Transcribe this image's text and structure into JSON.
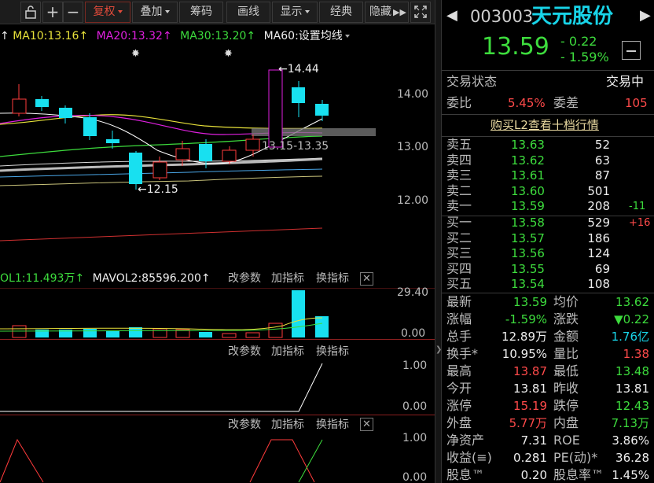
{
  "toolbar": {
    "fuquan": "复权",
    "diejia": "叠加",
    "chouma": "筹码",
    "huaxian": "画线",
    "xianshi": "显示",
    "jingdian": "经典",
    "yincang": "隐藏"
  },
  "ma_bar": {
    "ma10": "MA10:13.16",
    "ma20": "MA20:13.32",
    "ma30": "MA30:13.20",
    "ma60": "MA60:",
    "settings": "设置均线"
  },
  "price_axis": [
    "14.00",
    "13.00",
    "12.00"
  ],
  "annotations": {
    "high": "14.44",
    "low": "12.15",
    "range": "13.15-13.35"
  },
  "vol_bar": {
    "vol1": "OL1:11.493万",
    "mavol2": "MAVOL2:85596.200"
  },
  "indicator_buttons": {
    "change_params": "改参数",
    "add_indicator": "加指标",
    "switch_indicator": "换指标"
  },
  "vol_axis": [
    "29.40",
    "0.00"
  ],
  "ind1_axis": [
    "1.00",
    "0.00"
  ],
  "ind2_axis": [
    "1.00",
    "0.00"
  ],
  "colors": {
    "up": "#ff3b3b",
    "down": "#18e0f0",
    "ma10": "#e8e23a",
    "ma20": "#e020e0",
    "ma30": "#3ddc3d"
  },
  "header": {
    "code": "003003",
    "name": "天元股份",
    "price": "13.59",
    "change": "- 0.22",
    "change_pct": "- 1.59%"
  },
  "status": {
    "label": "交易状态",
    "value": "交易中"
  },
  "weibi": {
    "label": "委比",
    "value": "5.45%",
    "label2": "委差",
    "value2": "105"
  },
  "l2_link": "购买L2查看十档行情",
  "asks": [
    {
      "name": "卖五",
      "price": "13.63",
      "vol": "52",
      "delta": ""
    },
    {
      "name": "卖四",
      "price": "13.62",
      "vol": "63",
      "delta": ""
    },
    {
      "name": "卖三",
      "price": "13.61",
      "vol": "87",
      "delta": ""
    },
    {
      "name": "卖二",
      "price": "13.60",
      "vol": "501",
      "delta": ""
    },
    {
      "name": "卖一",
      "price": "13.59",
      "vol": "208",
      "delta": "-11"
    }
  ],
  "bids": [
    {
      "name": "买一",
      "price": "13.58",
      "vol": "529",
      "delta": "+16"
    },
    {
      "name": "买二",
      "price": "13.57",
      "vol": "186",
      "delta": ""
    },
    {
      "name": "买三",
      "price": "13.56",
      "vol": "124",
      "delta": ""
    },
    {
      "name": "买四",
      "price": "13.55",
      "vol": "69",
      "delta": ""
    },
    {
      "name": "买五",
      "price": "13.54",
      "vol": "108",
      "delta": ""
    }
  ],
  "stats": [
    {
      "l": "最新",
      "v": "13.59",
      "vc": "green",
      "l2": "均价",
      "v2": "13.62",
      "v2c": "green"
    },
    {
      "l": "涨幅",
      "v": "-1.59%",
      "vc": "green",
      "l2": "涨跌",
      "v2": "▼0.22",
      "v2c": "green"
    },
    {
      "l": "总手",
      "v": "12.89万",
      "vc": "white",
      "l2": "金额",
      "v2": "1.76亿",
      "v2c": "cyan"
    },
    {
      "l": "换手*",
      "v": "10.95%",
      "vc": "white",
      "l2": "量比",
      "v2": "1.38",
      "v2c": "red"
    },
    {
      "l": "最高",
      "v": "13.87",
      "vc": "red",
      "l2": "最低",
      "v2": "13.48",
      "v2c": "green"
    },
    {
      "l": "今开",
      "v": "13.81",
      "vc": "white",
      "l2": "昨收",
      "v2": "13.81",
      "v2c": "white"
    },
    {
      "l": "涨停",
      "v": "15.19",
      "vc": "red",
      "l2": "跌停",
      "v2": "12.43",
      "v2c": "green"
    },
    {
      "l": "外盘",
      "v": "5.77万",
      "vc": "red",
      "l2": "内盘",
      "v2": "7.13万",
      "v2c": "green"
    },
    {
      "l": "净资产",
      "v": "7.31",
      "vc": "white",
      "l2": "ROE",
      "v2": "3.86%",
      "v2c": "white"
    },
    {
      "l": "收益(≡)",
      "v": "0.281",
      "vc": "white",
      "l2": "PE(动)*",
      "v2": "36.28",
      "v2c": "white"
    },
    {
      "l": "股息™",
      "v": "0.20",
      "vc": "white",
      "l2": "股息率™",
      "v2": "1.45%",
      "v2c": "white"
    }
  ]
}
